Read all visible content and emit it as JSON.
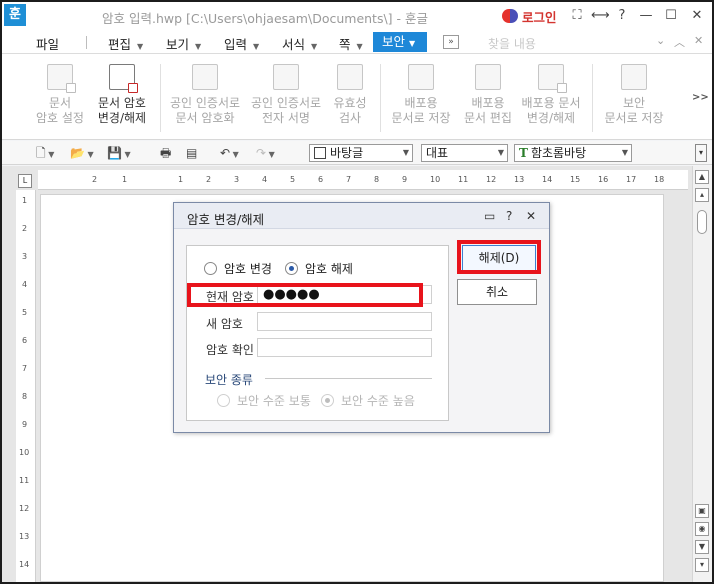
{
  "app": {
    "logo_glyph": "훈",
    "window_title": "암호 입력.hwp [C:\\Users\\ohjaesam\\Documents\\] - 훈글",
    "login_label": "로그인",
    "window_controls": {
      "fullscreen": "⛶",
      "resize": "⟷",
      "help": "?",
      "minimize": "—",
      "maximize": "☐",
      "close": "✕"
    }
  },
  "menu": {
    "items": [
      {
        "label": "파일"
      },
      {
        "label": "편집"
      },
      {
        "label": "보기"
      },
      {
        "label": "입력"
      },
      {
        "label": "서식"
      },
      {
        "label": "쪽"
      }
    ],
    "active": "보안",
    "expand_label": "»",
    "search_placeholder": "찾을 내용",
    "controls": {
      "collapse": "⌄",
      "up": "︿",
      "close": "✕"
    }
  },
  "ribbon": {
    "buttons": [
      {
        "line1": "문서",
        "line2": "암호 설정",
        "enabled": false
      },
      {
        "line1": "문서 암호",
        "line2": "변경/해제",
        "enabled": true
      },
      {
        "line1": "공인 인증서로",
        "line2": "문서 암호화",
        "enabled": false
      },
      {
        "line1": "공인 인증서로",
        "line2": "전자 서명",
        "enabled": false
      },
      {
        "line1": "유효성",
        "line2": "검사",
        "enabled": false
      },
      {
        "line1": "배포용",
        "line2": "문서로 저장",
        "enabled": false
      },
      {
        "line1": "배포용",
        "line2": "문서 편집",
        "enabled": false
      },
      {
        "line1": "배포용 문서",
        "line2": "변경/해제",
        "enabled": false
      },
      {
        "line1": "보안",
        "line2": "문서로 저장",
        "enabled": false
      }
    ],
    "more": ">>"
  },
  "toolbar": {
    "style_combo": "바탕글",
    "lang_combo": "대표",
    "font_combo": "함초롬바탕"
  },
  "ruler": {
    "h_ticks": [
      "2",
      "1",
      "1",
      "2",
      "3",
      "4",
      "5",
      "6",
      "7",
      "8",
      "9",
      "10",
      "11",
      "12",
      "13",
      "14",
      "15",
      "16",
      "17",
      "18"
    ],
    "v_ticks": [
      "1",
      "2",
      "3",
      "4",
      "5",
      "6",
      "7",
      "8",
      "9",
      "10",
      "11",
      "12",
      "13",
      "14"
    ]
  },
  "dialog": {
    "title": "암호 변경/해제",
    "help": "?",
    "close": "✕",
    "mode": {
      "change_label": "암호 변경",
      "remove_label": "암호 해제",
      "selected": "remove"
    },
    "fields": {
      "current_label": "현재 암호",
      "current_value": "●●●●●",
      "new_label": "새 암호",
      "new_value": "",
      "confirm_label": "암호 확인",
      "confirm_value": ""
    },
    "security": {
      "title": "보안 종류",
      "normal_label": "보안 수준 보통",
      "high_label": "보안 수준 높음",
      "selected": "high"
    },
    "buttons": {
      "remove": "해제(D)",
      "cancel": "취소"
    }
  },
  "colors": {
    "highlight": "#e8131b",
    "accent": "#1e88d8"
  }
}
